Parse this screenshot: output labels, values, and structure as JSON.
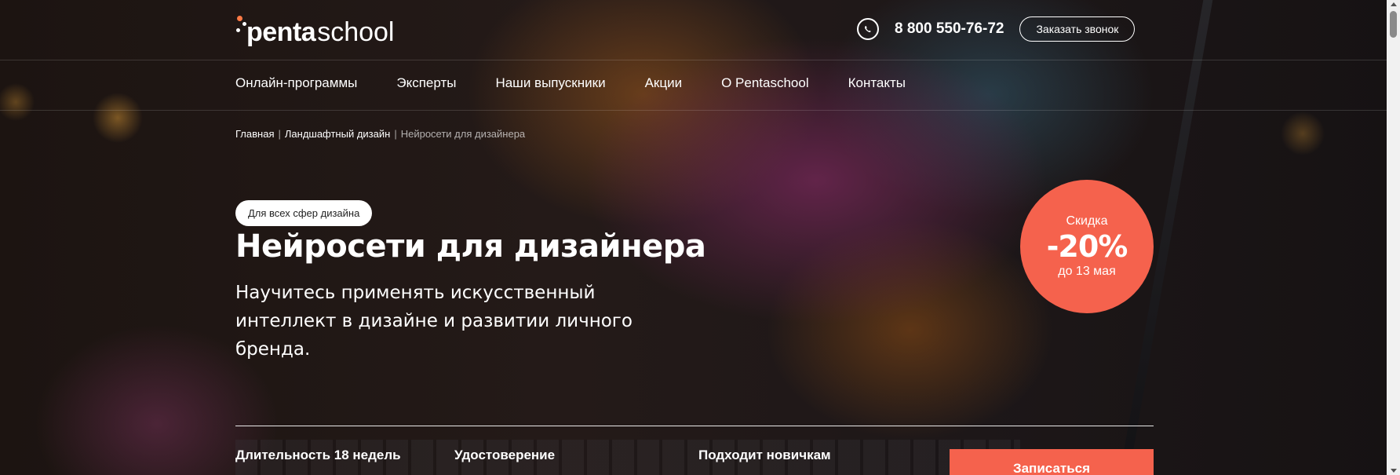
{
  "header": {
    "logo": {
      "penta": "penta",
      "school": "school"
    },
    "phone": "8 800 550-76-72",
    "callback_label": "Заказать звонок"
  },
  "nav": {
    "items": [
      {
        "label": "Онлайн-программы"
      },
      {
        "label": "Эксперты"
      },
      {
        "label": "Наши выпускники"
      },
      {
        "label": "Акции"
      },
      {
        "label": "О Pentaschool"
      },
      {
        "label": "Контакты"
      }
    ]
  },
  "breadcrumb": {
    "items": [
      {
        "label": "Главная"
      },
      {
        "label": "Ландшафтный дизайн"
      },
      {
        "label": "Нейросети для дизайнера"
      }
    ],
    "separator": "|"
  },
  "hero": {
    "tag": "Для всех сфер дизайна",
    "title": "Нейросети для дизайнера",
    "subtitle": "Научитесь применять искусственный интеллект в дизайне и развитии личного бренда."
  },
  "discount": {
    "label": "Скидка",
    "value": "-20%",
    "until": "до 13 мая"
  },
  "features": {
    "items": [
      {
        "label": "Длительность 18 недель"
      },
      {
        "label": "Удостоверение"
      },
      {
        "label": "Подходит новичкам"
      }
    ]
  },
  "cta": {
    "enroll_label": "Записаться"
  },
  "colors": {
    "accent": "#f5624d",
    "logo_dot": "#ff7a45",
    "text": "#ffffff"
  }
}
